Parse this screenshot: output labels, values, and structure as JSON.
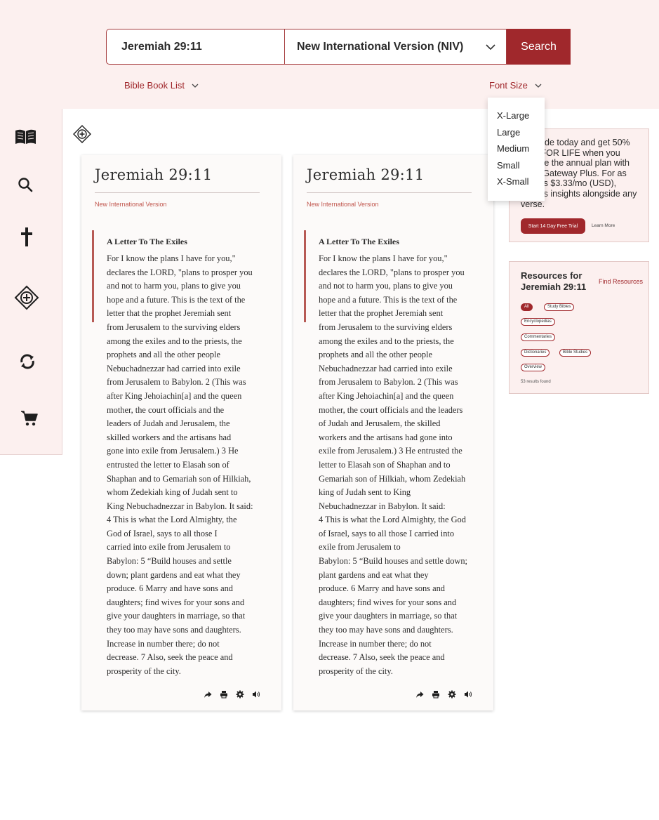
{
  "search": {
    "query": "Jeremiah 29:11",
    "version": "New International Version (NIV)",
    "button_label": "Search"
  },
  "nav": {
    "book_list_label": "Bible Book List",
    "font_size_label": "Font Size"
  },
  "font_menu": {
    "options": [
      "X-Large",
      "Large",
      "Medium",
      "Small",
      "X-Small"
    ]
  },
  "sidebar": {
    "icons": [
      "book-icon",
      "search-icon",
      "cross-icon",
      "add-parallel-icon",
      "refresh-icon",
      "cart-icon"
    ]
  },
  "passages": [
    {
      "title": "Jeremiah 29:11",
      "version": "New International Version",
      "heading": "A Letter To The Exiles",
      "text": "For I know the plans I have for you,\"\ndeclares the LORD, \"plans to prosper you\nand not to harm you, plans to give you\nhope and a future. This is the text of the\nletter that the prophet Jeremiah sent\nfrom Jerusalem to the surviving elders\namong the exiles and to the priests, the\nprophets and all the other people\nNebuchadnezzar had carried into exile\nfrom Jerusalem to Babylon. 2 (This was\nafter King Jehoiachin[a] and the queen\nmother, the court officials and the\nleaders of Judah and Jerusalem, the\nskilled workers and the artisans had\ngone into exile from Jerusalem.) 3 He\nentrusted the letter to Elasah son of\nShaphan and to Gemariah son of Hilkiah,\nwhom Zedekiah king of Judah sent to\nKing Nebuchadnezzar in Babylon. It said:\n4 This is what the Lord Almighty, the\nGod of Israel, says to all those I\ncarried into exile from Jerusalem to\nBabylon: 5 “Build houses and settle\ndown; plant gardens and eat what they\nproduce. 6 Marry and have sons and\ndaughters; find wives for your sons and\ngive your daughters in marriage, so that\nthey too may have sons and daughters.\nIncrease in number there; do not\ndecrease. 7 Also, seek the peace and\nprosperity of the city."
    },
    {
      "title": "Jeremiah 29:11",
      "version": "New International Version",
      "heading": "A Letter To The Exiles",
      "text": "For I know the plans I have for you,\"\ndeclares the LORD, \"plans to prosper you\nand not to harm you, plans to give you\nhope and a future. This is the text of the\nletter that the prophet Jeremiah sent\nfrom Jerusalem to the surviving elders\namong the exiles and to the priests, the\nprophets and all the other people\nNebuchadnezzar had carried into exile\nfrom Jerusalem to Babylon. 2 (This was\nafter King Jehoiachin[a] and the queen\nmother, the court officials and the leaders\nof Judah and Jerusalem, the skilled\nworkers and the artisans had gone into\nexile from Jerusalem.) 3 He entrusted the\nletter to Elasah son of Shaphan and to\nGemariah son of Hilkiah, whom Zedekiah\nking of Judah sent to King\nNebuchadnezzar in Babylon. It said:\n4 This is what the Lord Almighty, the God\nof Israel, says to all those I carried into\nexile from Jerusalem to\nBabylon: 5 “Build houses and settle down;\nplant gardens and eat what they\nproduce. 6 Marry and have sons and\ndaughters; find wives for your sons and\ngive your daughters in marriage, so that\nthey too may have sons and daughters.\nIncrease in number there; do not\ndecrease. 7 Also, seek the peace and\nprosperity of the city."
    }
  ],
  "tools": [
    "share-icon",
    "print-icon",
    "settings-icon",
    "audio-icon"
  ],
  "promo": {
    "text": "Upgrade today and get 50% OFF FOR LIFE when you choose the annual plan with Bible Gateway Plus. For as little as $3.33/mo (USD), access insights alongside any verse.",
    "button_label": "Start 14 Day Free Trial",
    "link_label": "Learn More"
  },
  "resources": {
    "title": "Resources for Jeremiah 29:11",
    "find_label": "Find Resources",
    "chips": [
      "All",
      "Study Bibles",
      "Encyclopedias",
      "Commentaries",
      "Dictionaries",
      "Bible Studies",
      "Overview"
    ],
    "active_chip": "All",
    "count_text": "53 results found"
  },
  "colors": {
    "accent": "#a0282c",
    "background_tint": "#fcf0ef",
    "card": "#fcfaf9",
    "verse_bar": "#b75a55"
  }
}
